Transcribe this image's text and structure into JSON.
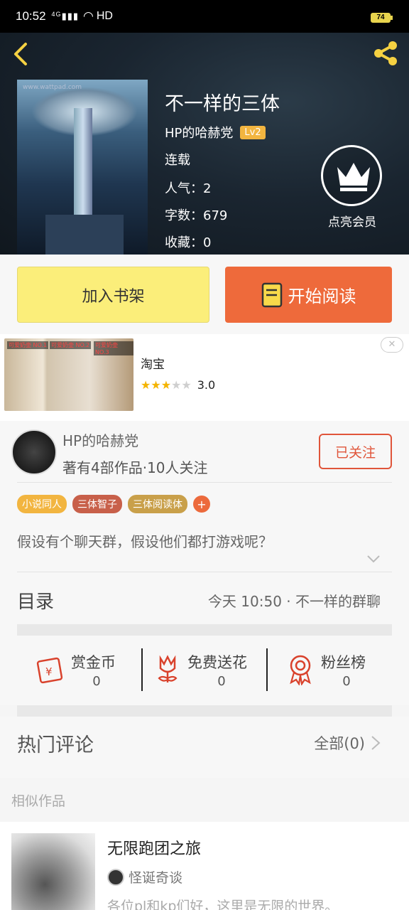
{
  "status": {
    "time": "10:52",
    "signal": "4G",
    "network": "HD",
    "battery": "74"
  },
  "book": {
    "title": "不一样的三体",
    "author": "HP的哈赫党",
    "level": "Lv2",
    "state": "连载",
    "popularity": "人气：2",
    "words": "字数：679",
    "favorites": "收藏：0",
    "vip_label": "点亮会员",
    "cover_watermark": "www.wattpad.com"
  },
  "actions": {
    "add_shelf": "加入书架",
    "start_read": "开始阅读"
  },
  "ad": {
    "title": "淘宝",
    "rating": "3.0",
    "stars_on": 3,
    "close": "✕",
    "thumb_labels": [
      "可爱奶壶 NO.1",
      "可爱奶壶 NO.2",
      "可爱奶壶 NO.3"
    ]
  },
  "author_card": {
    "name": "HP的哈赫党",
    "stats": "著有4部作品·10人关注",
    "follow_btn": "已关注",
    "tags": [
      {
        "label": "小说同人",
        "color": "#f2b540"
      },
      {
        "label": "三体智子",
        "color": "#c8604a"
      },
      {
        "label": "三体阅读体",
        "color": "#c9a04a"
      }
    ],
    "tag_plus": "+",
    "intro": "假设有个聊天群，假设他们都打游戏呢？"
  },
  "catalog": {
    "label": "目录",
    "latest": "今天 10:50 · 不一样的群聊"
  },
  "rewards": [
    {
      "label": "赏金币",
      "count": "0",
      "icon": "red-envelope-icon"
    },
    {
      "label": "免费送花",
      "count": "0",
      "icon": "flower-icon"
    },
    {
      "label": "粉丝榜",
      "count": "0",
      "icon": "medal-icon"
    }
  ],
  "comments": {
    "label": "热门评论",
    "all": "全部(0)"
  },
  "similar": {
    "heading": "相似作品",
    "items": [
      {
        "title": "无限跑团之旅",
        "author": "怪诞奇谈",
        "desc": "各位pl和kp们好，这里是无限的世界。"
      }
    ]
  },
  "colors": {
    "accent": "#ee6a3b",
    "shelf": "#fbee7a",
    "follow": "#e0553a",
    "icon_yellow": "#f5d142"
  }
}
